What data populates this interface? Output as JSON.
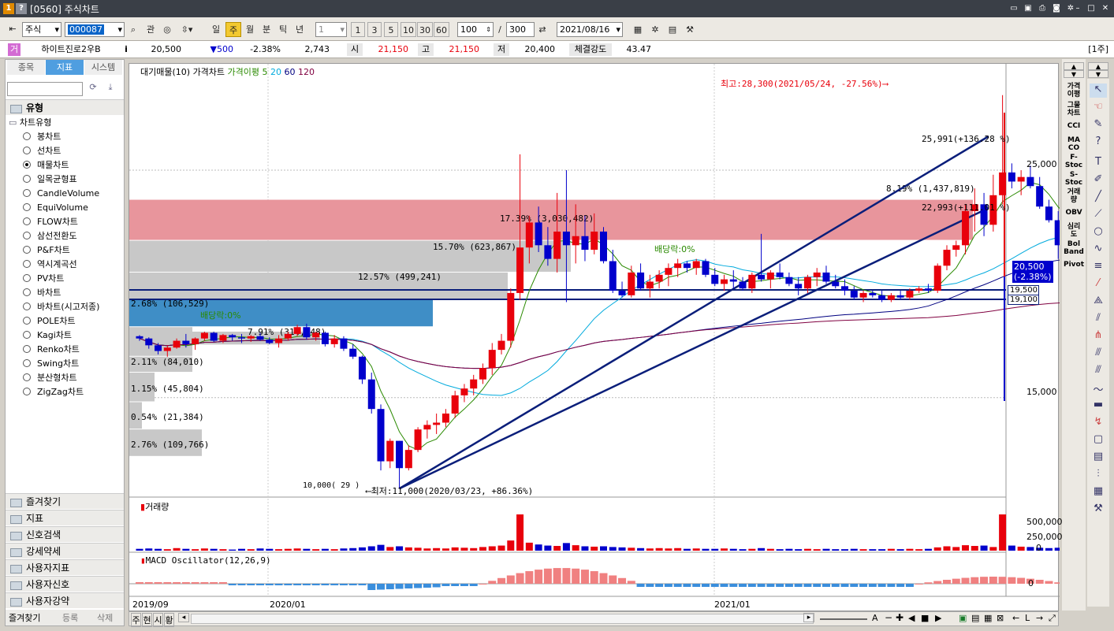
{
  "window": {
    "title": "[0560] 주식차트",
    "badge1": "1",
    "badge2": "?"
  },
  "toolbar": {
    "market": "주식",
    "code": "000087",
    "gwan": "관",
    "periods": [
      "일",
      "주",
      "월",
      "분",
      "틱",
      "년"
    ],
    "active_period": "주",
    "interval_value": "1",
    "quick": [
      "1",
      "3",
      "5",
      "10",
      "30",
      "60"
    ],
    "count": "100",
    "total": "300",
    "date": "2021/08/16"
  },
  "quote": {
    "tag": "거",
    "name": "하이트진로2우B",
    "info": "i",
    "price": "20,500",
    "change": "▼500",
    "rate": "-2.38%",
    "volume": "2,743",
    "open_label": "시",
    "open": "21,150",
    "high_label": "고",
    "high": "21,150",
    "low_label": "저",
    "low": "20,400",
    "strength_label": "체결강도",
    "strength": "43.47",
    "unit": "[1주]"
  },
  "left": {
    "tabs": [
      "종목",
      "지표",
      "시스템"
    ],
    "active_tab": "지표",
    "group_title": "유형",
    "tree_root": "차트유형",
    "items": [
      "봉차트",
      "선차트",
      "매물차트",
      "일목균형표",
      "CandleVolume",
      "EquiVolume",
      "FLOW차트",
      "삼선전환도",
      "P&F차트",
      "역시계곡선",
      "PV차트",
      "바차트",
      "바차트(시고저종)",
      "POLE차트",
      "Kagi차트",
      "Renko차트",
      "Swing차트",
      "분산형차트",
      "ZigZag차트"
    ],
    "selected": "매물차트",
    "sections": [
      "즐겨찾기",
      "지표",
      "신호검색",
      "강세약세",
      "사용자지표",
      "사용자신호",
      "사용자강약"
    ],
    "footer": [
      "즐겨찾기",
      "등록",
      "삭제"
    ]
  },
  "chart": {
    "legend": {
      "a": "대기매물(10)",
      "b": "가격차트",
      "c": "가격이평 5",
      "d": "20",
      "e": "60",
      "f": "120"
    },
    "high_note": "최고:28,300(2021/05/24, -27.56%)⟶",
    "low_note": "⟵최저:11,000(2020/03/23, +86.36%)",
    "low_ticks": "10,000( 29 )",
    "trend1": "25,991(+136.28 %)",
    "trend2": "22,993(+111.01 %)",
    "dividend1": "배당락:0%",
    "dividend2": "배당락:0%",
    "vp_labels": [
      "8.19% (1,437,819)",
      "17.39% (3,030,482)",
      "15.70% (623,867)",
      "12.57% (499,241)",
      "2.68% (106,529)",
      "7.91% (314,348)",
      "2.11% (84,010)",
      "1.15% (45,804)",
      "0.54% (21,384)",
      "2.76% (109,766)"
    ],
    "y_labels": [
      "25,000",
      "15,000"
    ],
    "cur_price": "20,500",
    "cur_rate": "(-2.38%)",
    "line1": "19,500",
    "line2": "19,100",
    "volume_title": "거래량",
    "vol_labels": [
      "500,000",
      "250,000",
      "0"
    ],
    "macd_title": "MACD Oscillator(12,26,9)",
    "macd_zero": "0",
    "x_labels": [
      "2019/09",
      "2020/01",
      "2021/01"
    ]
  },
  "bottom": {
    "tabs": [
      "주",
      "현",
      "시",
      "황"
    ]
  },
  "right_labels": [
    "가격\n이평",
    "그물\n차트",
    "CCI",
    "MA\nCO",
    "F-\nStoc",
    "S-\nStoc",
    "거래\n량",
    "OBV",
    "심리\n도",
    "Bol\nBand",
    "Pivot"
  ],
  "colors": {
    "up": "#e8000b",
    "down": "#0000cc",
    "ma5": "#2a8a00",
    "ma20": "#00aadd",
    "ma60": "#000080",
    "ma120": "#800040",
    "accent": "#0058d6"
  },
  "chart_data": {
    "type": "candlestick",
    "candles": [
      [
        17700,
        17750,
        17500,
        17600
      ],
      [
        17600,
        17650,
        17150,
        17300
      ],
      [
        17300,
        17400,
        16900,
        17050
      ],
      [
        17050,
        17300,
        16800,
        17200
      ],
      [
        17200,
        17600,
        17150,
        17500
      ],
      [
        17500,
        17800,
        17200,
        17350
      ],
      [
        17350,
        17650,
        17100,
        17600
      ],
      [
        17600,
        17900,
        17500,
        17850
      ],
      [
        17850,
        17900,
        17450,
        17500
      ],
      [
        17500,
        17800,
        17400,
        17750
      ],
      [
        17750,
        17800,
        17500,
        17650
      ],
      [
        17650,
        17800,
        17400,
        17600
      ],
      [
        17600,
        17750,
        17450,
        17700
      ],
      [
        17700,
        17850,
        17500,
        17550
      ],
      [
        17550,
        17650,
        17350,
        17400
      ],
      [
        17400,
        17750,
        17200,
        17600
      ],
      [
        17600,
        17900,
        17500,
        17800
      ],
      [
        17800,
        18200,
        17700,
        18100
      ],
      [
        18100,
        18250,
        17550,
        17650
      ],
      [
        17650,
        17900,
        17500,
        17850
      ],
      [
        17850,
        17900,
        17250,
        17350
      ],
      [
        17350,
        17750,
        17200,
        17600
      ],
      [
        17600,
        17700,
        17050,
        17150
      ],
      [
        17150,
        17350,
        16700,
        16800
      ],
      [
        16800,
        16850,
        15600,
        15800
      ],
      [
        15800,
        16100,
        14300,
        14500
      ],
      [
        14500,
        14700,
        11800,
        12200
      ],
      [
        12200,
        13200,
        11900,
        13100
      ],
      [
        13100,
        13100,
        11000,
        11900
      ],
      [
        11900,
        12900,
        11800,
        12700
      ],
      [
        12700,
        13700,
        12600,
        13600
      ],
      [
        13600,
        14000,
        13200,
        13800
      ],
      [
        13800,
        14300,
        13400,
        13900
      ],
      [
        13900,
        14500,
        13700,
        14300
      ],
      [
        14300,
        15300,
        14100,
        15100
      ],
      [
        15100,
        15600,
        14800,
        15400
      ],
      [
        15400,
        16000,
        15100,
        15800
      ],
      [
        15800,
        16500,
        15600,
        16300
      ],
      [
        16300,
        17400,
        16000,
        17100
      ],
      [
        17100,
        17800,
        16900,
        17500
      ],
      [
        17500,
        19800,
        17200,
        19600
      ],
      [
        19600,
        25700,
        19300,
        21600
      ],
      [
        21600,
        23000,
        20900,
        22700
      ],
      [
        22700,
        23400,
        21400,
        21700
      ],
      [
        21700,
        22500,
        20800,
        21100
      ],
      [
        21100,
        24000,
        20500,
        22300
      ],
      [
        22300,
        25000,
        19200,
        21700
      ],
      [
        21700,
        23500,
        20900,
        22100
      ],
      [
        22100,
        23000,
        21000,
        21500
      ],
      [
        21500,
        23100,
        21300,
        22300
      ],
      [
        22300,
        22500,
        20900,
        21000
      ],
      [
        21000,
        21500,
        19600,
        19700
      ],
      [
        19700,
        20100,
        19400,
        19500
      ],
      [
        19500,
        20800,
        19400,
        20500
      ],
      [
        20500,
        20900,
        19700,
        19800
      ],
      [
        19800,
        20400,
        19400,
        20100
      ],
      [
        20100,
        20600,
        19800,
        20400
      ],
      [
        20400,
        20900,
        19900,
        20700
      ],
      [
        20700,
        21100,
        20300,
        20900
      ],
      [
        20900,
        21000,
        20500,
        20700
      ],
      [
        20700,
        21100,
        20400,
        21000
      ],
      [
        21000,
        21100,
        20300,
        20400
      ],
      [
        20400,
        20700,
        19900,
        20000
      ],
      [
        20000,
        20400,
        19700,
        20200
      ],
      [
        20200,
        20600,
        19800,
        20100
      ],
      [
        20100,
        20300,
        19700,
        19800
      ],
      [
        19800,
        20500,
        19600,
        20400
      ],
      [
        20400,
        22200,
        20100,
        20200
      ],
      [
        20200,
        20600,
        19800,
        20500
      ],
      [
        20500,
        20900,
        20200,
        20300
      ],
      [
        20300,
        20500,
        19900,
        20000
      ],
      [
        20000,
        20300,
        19500,
        19800
      ],
      [
        19800,
        20400,
        19600,
        20300
      ],
      [
        20300,
        20700,
        19900,
        20500
      ],
      [
        20500,
        20800,
        20000,
        20100
      ],
      [
        20100,
        20400,
        19800,
        19900
      ],
      [
        19900,
        20200,
        19500,
        19700
      ],
      [
        19700,
        19900,
        19300,
        19400
      ],
      [
        19400,
        19700,
        19200,
        19600
      ],
      [
        19600,
        19700,
        19400,
        19500
      ],
      [
        19500,
        19700,
        19200,
        19300
      ],
      [
        19300,
        19600,
        19200,
        19500
      ],
      [
        19500,
        19700,
        19300,
        19400
      ],
      [
        19400,
        19800,
        19300,
        19700
      ],
      [
        19700,
        19900,
        19600,
        19800
      ],
      [
        19800,
        20000,
        19600,
        19700
      ],
      [
        19700,
        20900,
        19600,
        20800
      ],
      [
        20800,
        21700,
        20600,
        21500
      ],
      [
        21500,
        21900,
        21200,
        21700
      ],
      [
        21700,
        23500,
        21300,
        23200
      ],
      [
        23200,
        24200,
        22300,
        23500
      ],
      [
        23500,
        24000,
        22100,
        22600
      ],
      [
        22600,
        24800,
        22300,
        23900
      ],
      [
        23900,
        28300,
        23500,
        24900
      ],
      [
        24900,
        25300,
        24200,
        24500
      ],
      [
        24500,
        25000,
        23900,
        24700
      ],
      [
        24700,
        25200,
        24200,
        24300
      ],
      [
        24300,
        24700,
        23300,
        23400
      ],
      [
        23400,
        23700,
        22700,
        22800
      ],
      [
        22800,
        23200,
        21100,
        21700
      ],
      [
        21700,
        24300,
        21500,
        22800
      ],
      [
        22800,
        23300,
        21600,
        21800
      ],
      [
        21800,
        22300,
        21100,
        21200
      ],
      [
        21200,
        21400,
        21000,
        21100
      ],
      [
        21100,
        21400,
        20400,
        20500
      ]
    ],
    "ylim": [
      10800,
      29400
    ],
    "y_ticks": [
      25000,
      15000
    ],
    "x_ticks": [
      "2019/09",
      "2020/01",
      "2021/01"
    ]
  }
}
